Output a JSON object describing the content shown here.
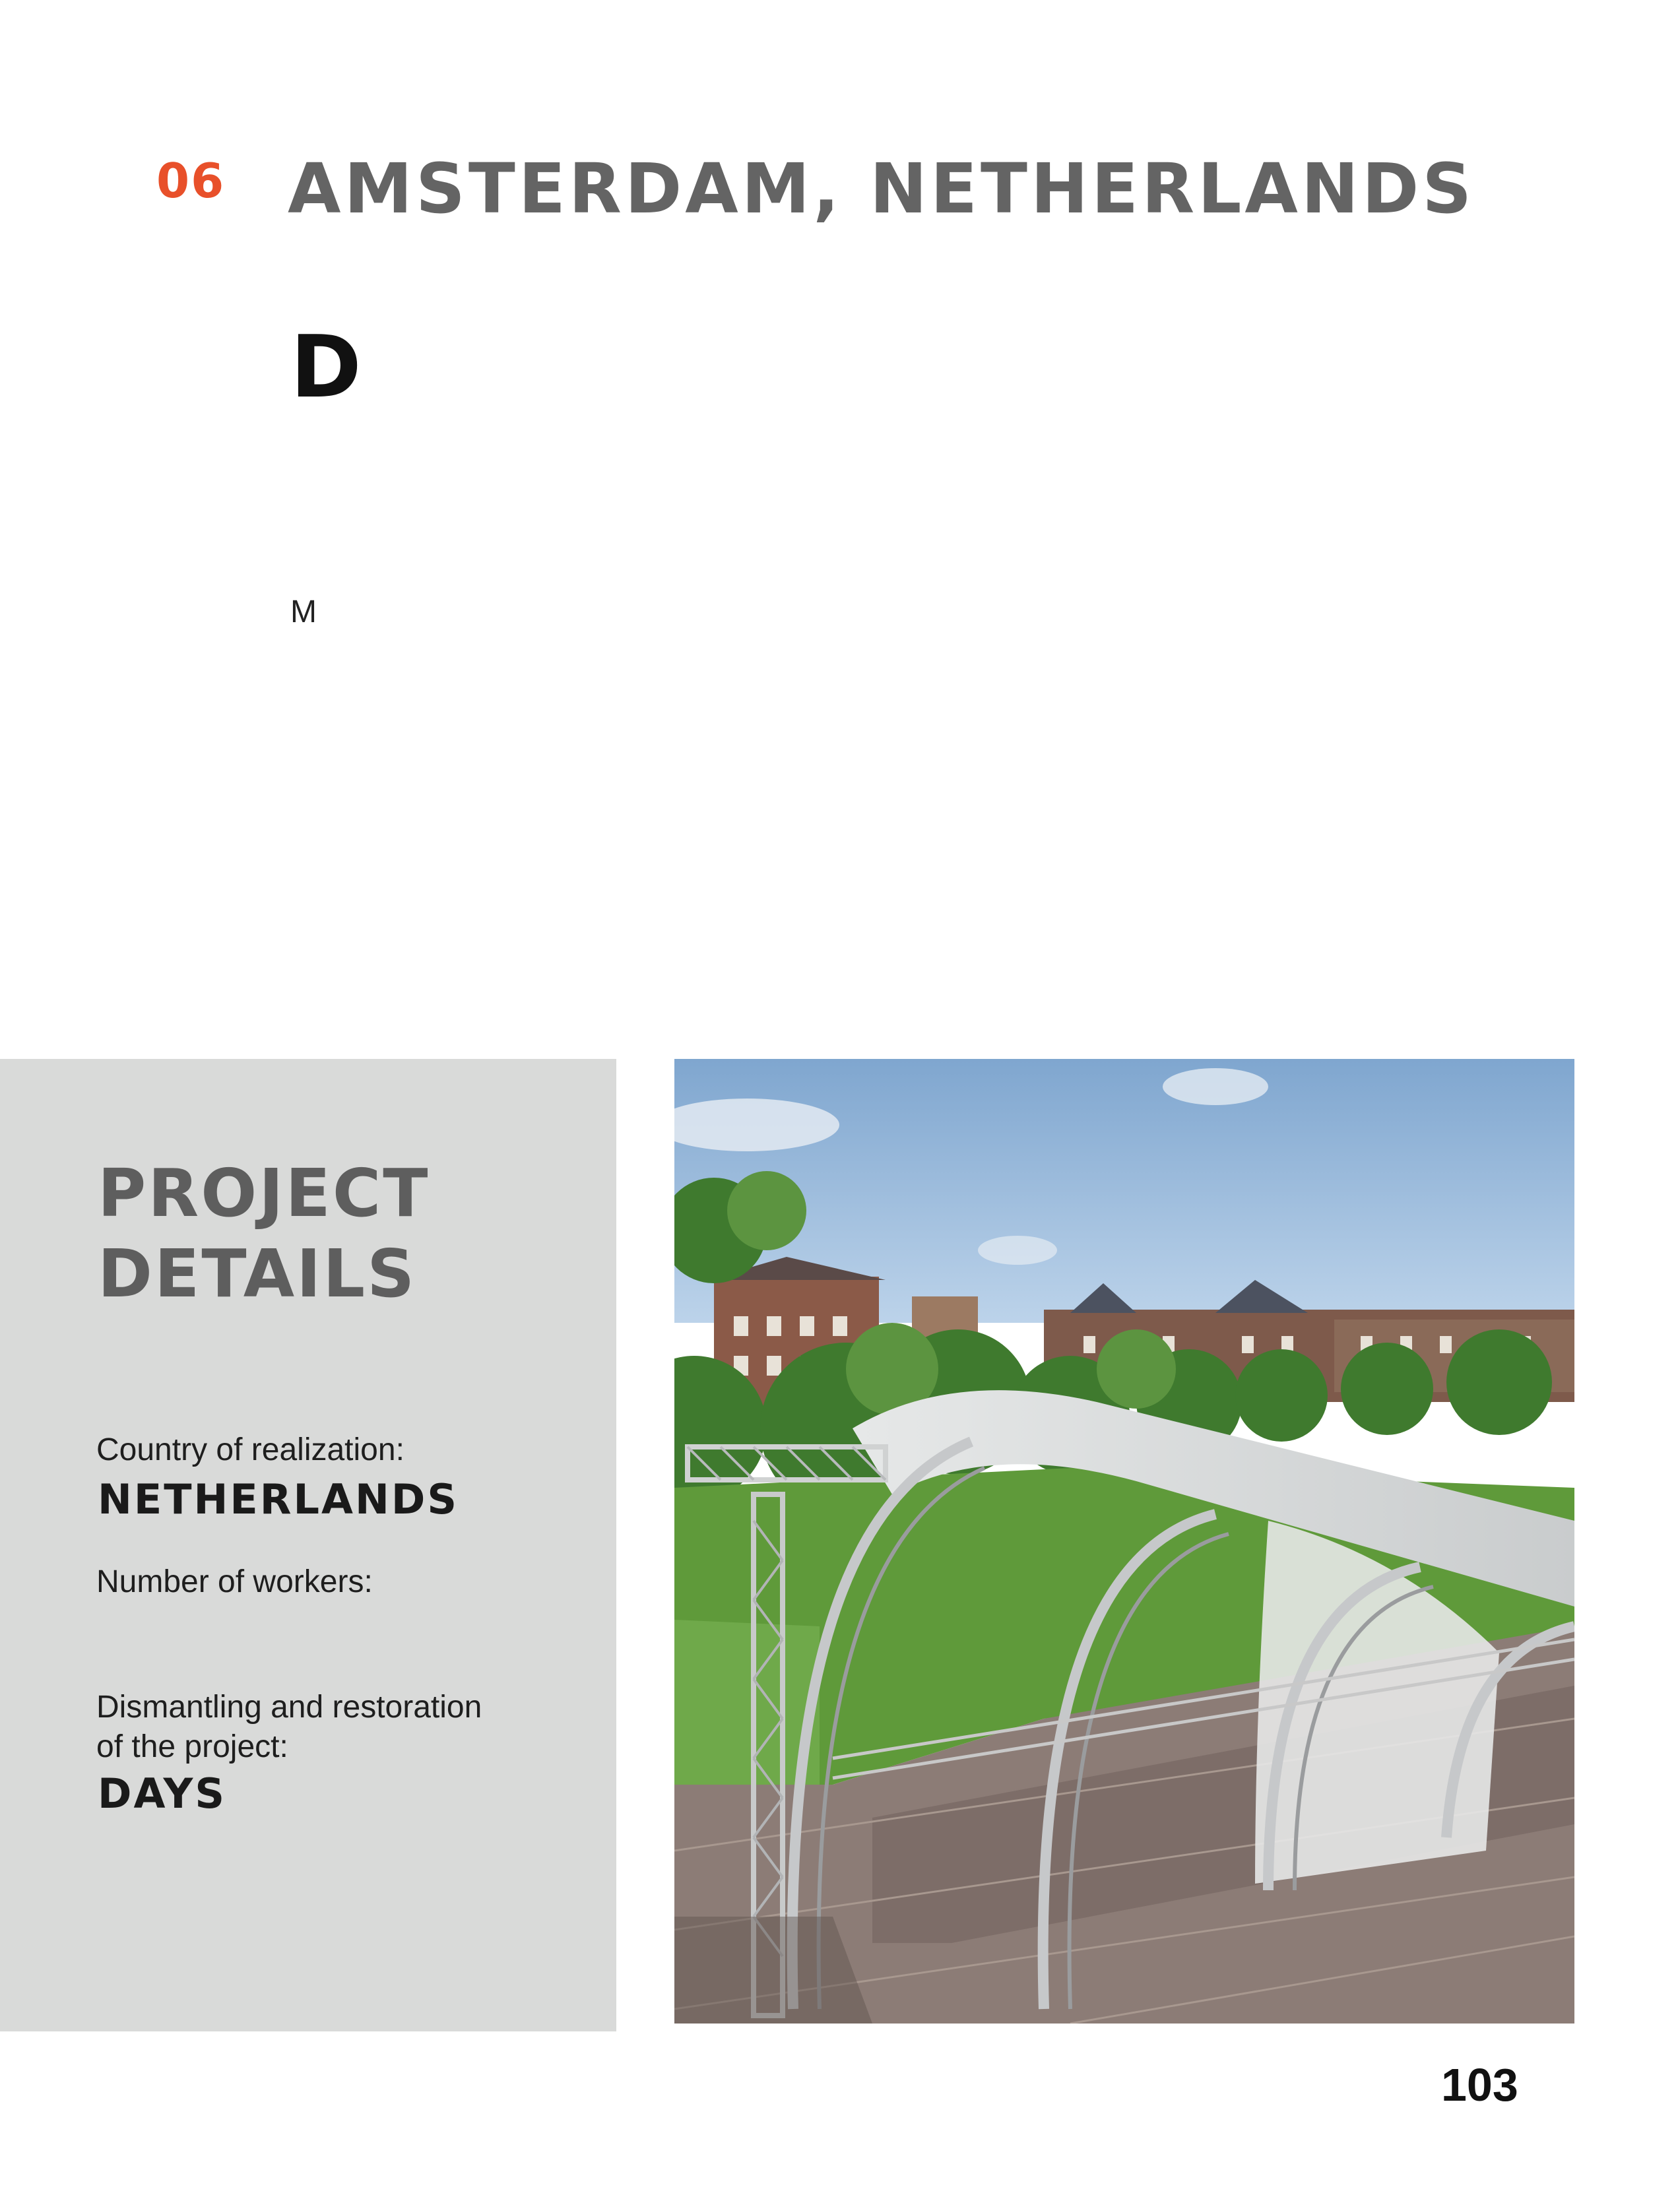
{
  "header": {
    "section_number": "06",
    "title": "AMSTERDAM, NETHERLANDS"
  },
  "intro": {
    "drop_letter": "D",
    "body_letter": "M"
  },
  "project_details": {
    "heading_line1": "PROJECT",
    "heading_line2": "DETAILS",
    "country_label": "Country of realization:",
    "country_value": "NETHERLANDS",
    "workers_label": "Number of workers:",
    "dismantling_label_line1": "Dismantling and restoration",
    "dismantling_label_line2": "of the project:",
    "dismantling_value": "DAYS"
  },
  "photo": {
    "subject": "stage-truss-structure-photo"
  },
  "footer": {
    "page_number": "103"
  }
}
